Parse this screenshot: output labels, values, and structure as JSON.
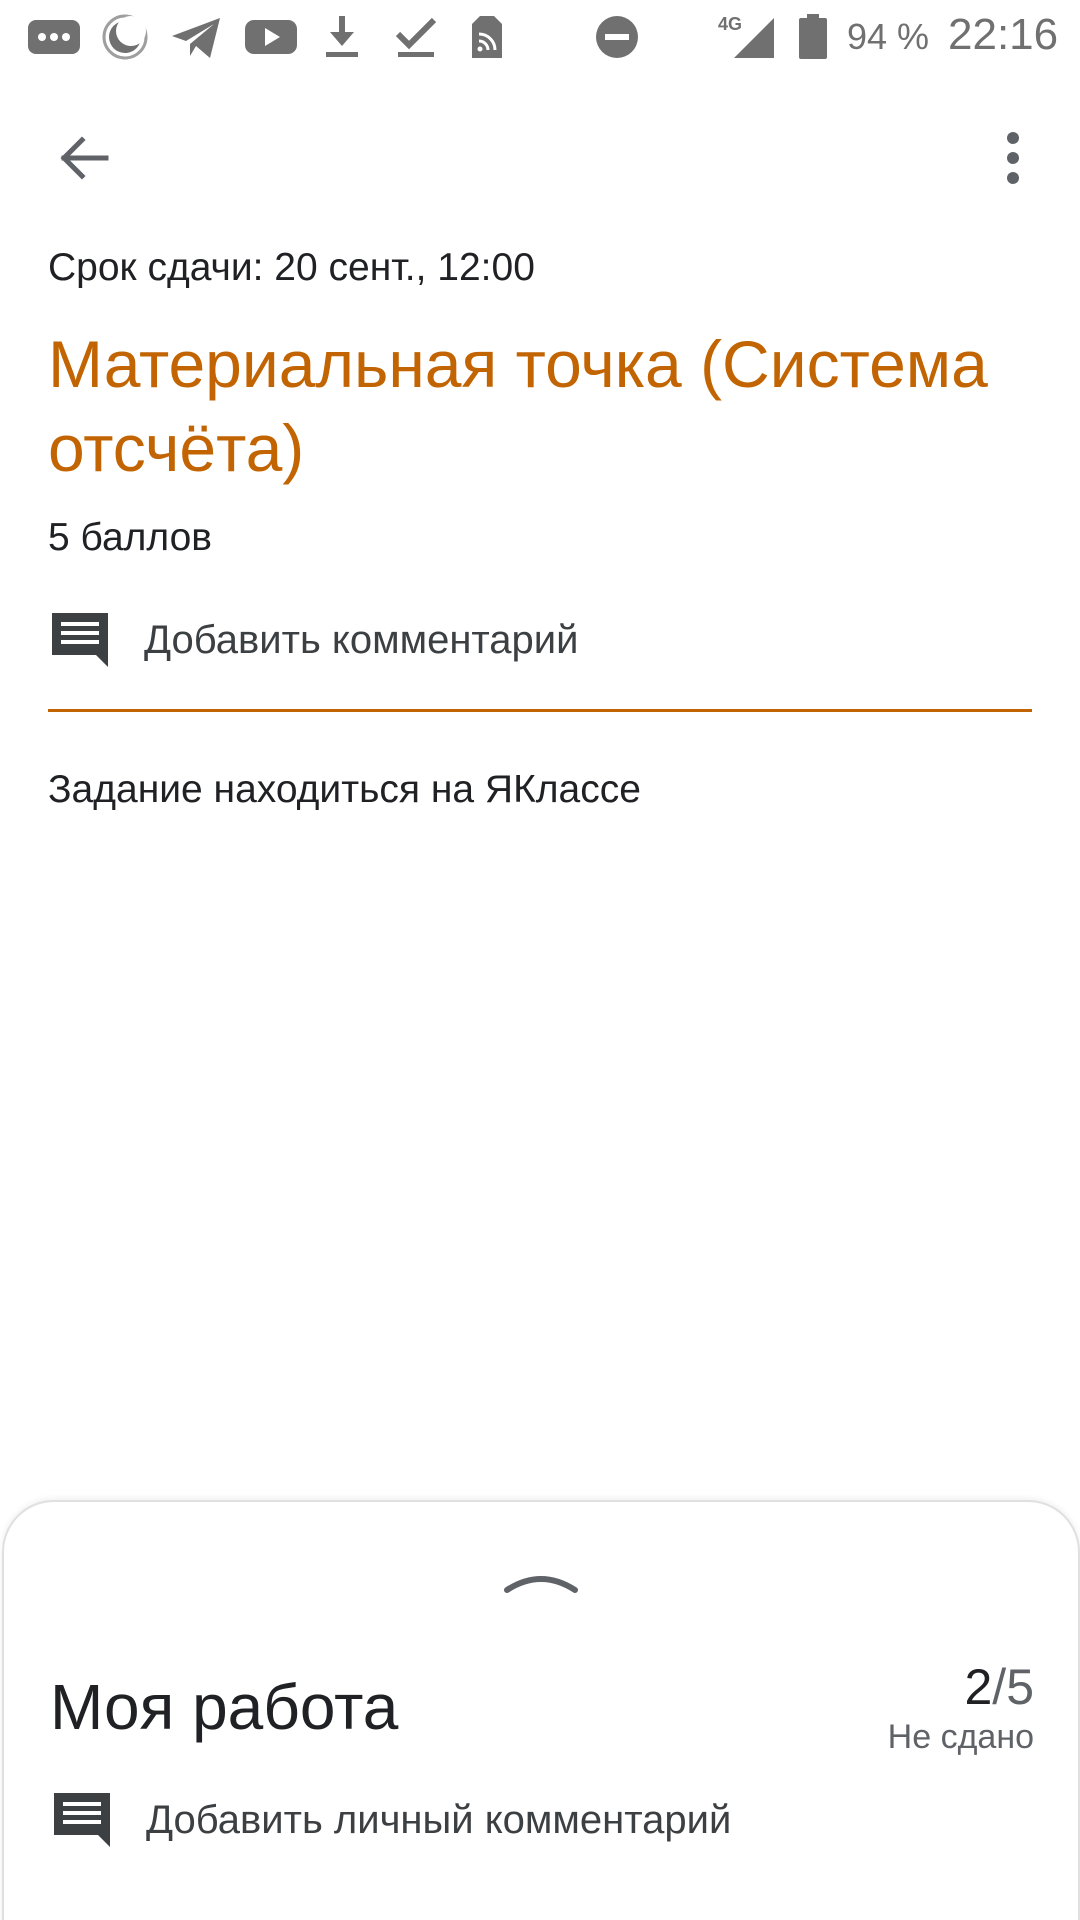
{
  "status_bar": {
    "icons": [
      "chat-bubble-icon",
      "night-mode-icon",
      "telegram-icon",
      "youtube-icon",
      "download-icon",
      "check-icon",
      "wifi-tag-icon",
      "do-not-disturb-icon",
      "signal-4g-icon",
      "battery-icon"
    ],
    "network_label": "4G",
    "battery_percent": "94 %",
    "time": "22:16"
  },
  "app_bar": {
    "back_icon": "arrow-back-icon",
    "more_icon": "more-vertical-icon"
  },
  "assignment": {
    "due_date": "Срок сдачи: 20 сент., 12:00",
    "title": "Материальная точка (Система отсчёта)",
    "points": "5 баллов",
    "add_comment_label": "Добавить комментарий",
    "description": "Задание находиться на ЯКлассе"
  },
  "my_work": {
    "title": "Моя работа",
    "grade_value": "2",
    "grade_separator": "/",
    "grade_max": "5",
    "status": "Не сдано",
    "add_private_comment_label": "Добавить личный комментарий"
  },
  "colors": {
    "accent": "#c26401",
    "text_primary": "#202124",
    "text_secondary": "#5f6368",
    "status_bar_icons": "#707070"
  }
}
